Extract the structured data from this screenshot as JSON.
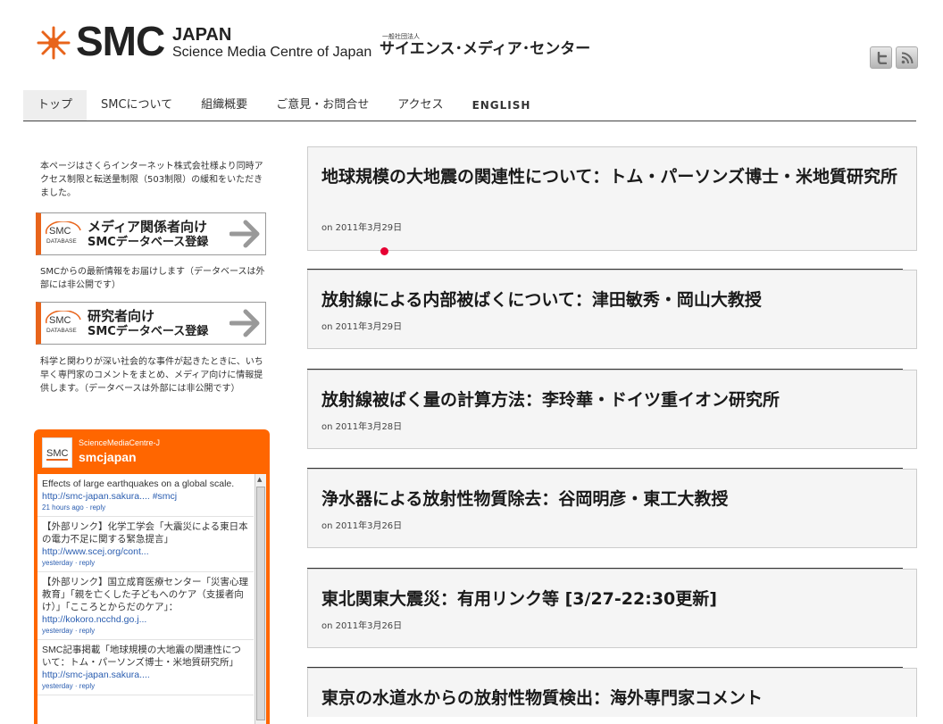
{
  "header": {
    "logo_smc": "SMC",
    "logo_japan": "JAPAN",
    "logo_full": "Science Media Centre of Japan",
    "logo_jp_small": "一般社団法人",
    "logo_jp": "サイエンス･メディア･センター"
  },
  "nav": {
    "items": [
      {
        "label": "トップ"
      },
      {
        "label": "SMCについて"
      },
      {
        "label": "組織概要"
      },
      {
        "label": "ご意見・お問合せ"
      },
      {
        "label": "アクセス"
      },
      {
        "label": "ENGLISH"
      }
    ]
  },
  "sidebar": {
    "notice": "本ページはさくらインターネット株式会社様より同時アクセス制限と転送量制限（503制限）の緩和をいただきました。",
    "banner_media": {
      "logo_top": "SMC",
      "logo_bottom": "DATABASE",
      "line1": "メディア関係者向け",
      "line2": "SMCデータベース登録"
    },
    "media_desc": "SMCからの最新情報をお届けします（データベースは外部には非公開です）",
    "banner_research": {
      "logo_top": "SMC",
      "logo_bottom": "DATABASE",
      "line1": "研究者向け",
      "line2": "SMCデータベース登録"
    },
    "research_desc": "科学と関わりが深い社会的な事件が起きたときに、いち早く専門家のコメントをまとめ、メディア向けに情報提供します。（データベースは外部には非公開です）"
  },
  "twitter": {
    "account_sub": "ScienceMediaCentre-J",
    "account_name": "smcjapan",
    "avatar_label": "SMC",
    "tweets": [
      {
        "text": "Effects of large earthquakes on a global scale. ",
        "link": "http://smc-japan.sakura.... #smcj",
        "meta": "21 hours ago · reply"
      },
      {
        "text": "【外部リンク】化学工学会「大震災による東日本の電力不足に関する緊急提言」",
        "link": "http://www.scej.org/cont...",
        "meta": "yesterday · reply"
      },
      {
        "text": "【外部リンク】国立成育医療センター「災害心理教育」「親を亡くした子どもへのケア（支援者向け）」「こころとからだのケア」： ",
        "link": "http://kokoro.ncchd.go.j...",
        "meta": "yesterday · reply"
      },
      {
        "text": "SMC記事掲載「地球規模の大地震の関連性について：トム・パーソンズ博士・米地質研究所」 ",
        "link": "http://smc-japan.sakura....",
        "meta": "yesterday · reply"
      }
    ]
  },
  "posts": [
    {
      "title": "地球規模の大地震の関連性について：トム・パーソンズ博士・米地質研究所",
      "date": "on 2011年3月29日"
    },
    {
      "title": "放射線による内部被ばくについて：津田敏秀・岡山大教授",
      "date": "on 2011年3月29日"
    },
    {
      "title": "放射線被ばく量の計算方法：李玲華・ドイツ重イオン研究所",
      "date": "on 2011年3月28日"
    },
    {
      "title": "浄水器による放射性物質除去：谷岡明彦・東工大教授",
      "date": "on 2011年3月26日"
    },
    {
      "title": "東北関東大震災：有用リンク等 [3/27-22:30更新]",
      "date": "on 2011年3月26日"
    },
    {
      "title": "東京の水道水からの放射性物質検出：海外専門家コメント",
      "date": ""
    }
  ],
  "colors": {
    "accent": "#e8641b",
    "twitter_orange": "#ff6600",
    "link": "#2a5db0"
  }
}
